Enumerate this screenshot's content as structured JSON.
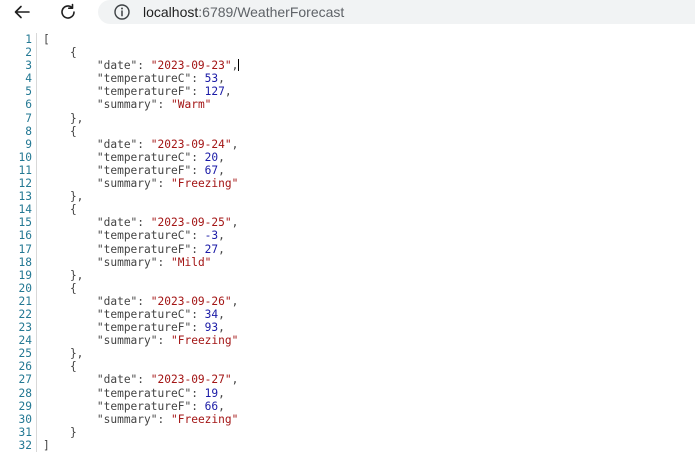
{
  "browser": {
    "url_host": "localhost",
    "url_rest": ":6789/WeatherForecast"
  },
  "icons": {
    "back": "back-arrow-icon",
    "reload": "reload-icon",
    "info": "info-icon"
  },
  "colors": {
    "line_number": "#237893",
    "string": "#a31515",
    "number": "#1a1aa6",
    "key": "#444444"
  },
  "forecasts": [
    {
      "date": "2023-09-23",
      "temperatureC": 53,
      "temperatureF": 127,
      "summary": "Warm"
    },
    {
      "date": "2023-09-24",
      "temperatureC": 20,
      "temperatureF": 67,
      "summary": "Freezing"
    },
    {
      "date": "2023-09-25",
      "temperatureC": -3,
      "temperatureF": 27,
      "summary": "Mild"
    },
    {
      "date": "2023-09-26",
      "temperatureC": 34,
      "temperatureF": 93,
      "summary": "Freezing"
    },
    {
      "date": "2023-09-27",
      "temperatureC": 19,
      "temperatureF": 66,
      "summary": "Freezing"
    }
  ]
}
